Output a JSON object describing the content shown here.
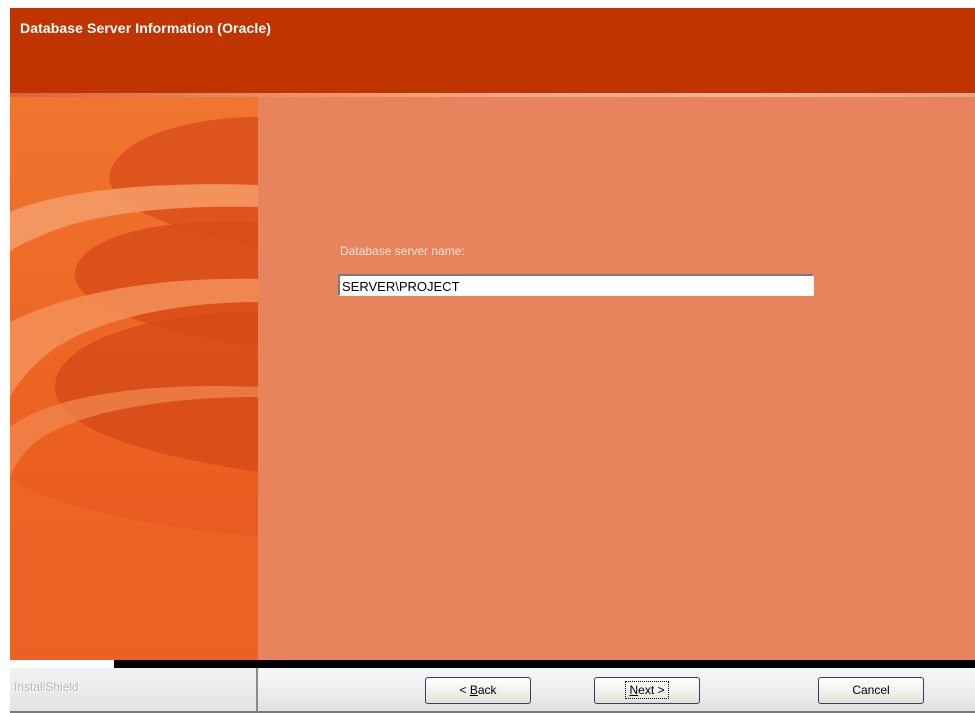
{
  "window": {
    "title": "Database Server Information (Oracle)"
  },
  "colors": {
    "banner": "#bf3400",
    "content_background": "#e8845d",
    "side_art": "#e8561f",
    "label_text": "#fbe3d6"
  },
  "form": {
    "server_label": "Database server name:",
    "server_value": "SERVER\\PROJECT"
  },
  "footer": {
    "brand": "InstallShield",
    "back_prefix": "< ",
    "back_key": "B",
    "back_rest": "ack",
    "next_key": "N",
    "next_rest": "ext >",
    "cancel_label": "Cancel"
  }
}
